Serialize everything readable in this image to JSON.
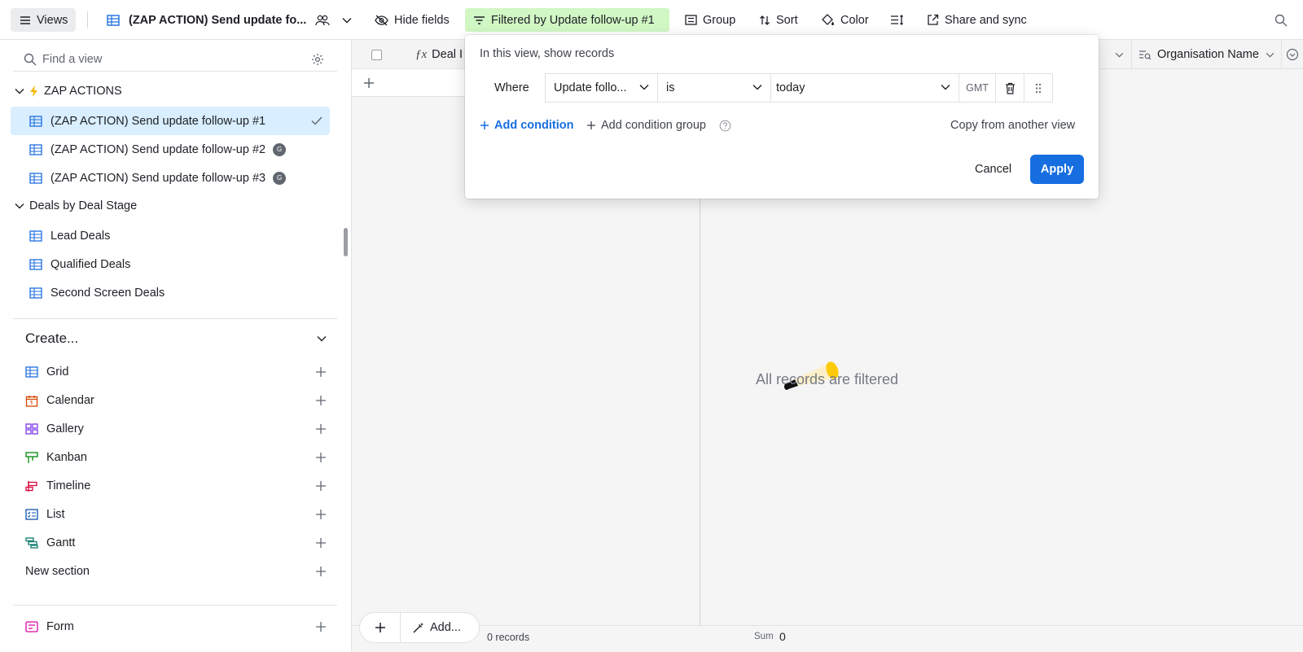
{
  "toolbar": {
    "views_label": "Views",
    "view_name": "(ZAP ACTION) Send update fo...",
    "hide_fields": "Hide fields",
    "filter": "Filtered by Update follow-up #1",
    "group": "Group",
    "sort": "Sort",
    "color": "Color",
    "share": "Share and sync"
  },
  "sidebar": {
    "find_placeholder": "Find a view",
    "sections": [
      {
        "title": "ZAP ACTIONS",
        "items": [
          {
            "label": "(ZAP ACTION) Send update follow-up #1",
            "active": true
          },
          {
            "label": "(ZAP ACTION) Send update follow-up #2",
            "badge": "G"
          },
          {
            "label": "(ZAP ACTION) Send update follow-up #3",
            "badge": "G"
          }
        ]
      },
      {
        "title": "Deals by Deal Stage",
        "items": [
          {
            "label": "Lead Deals"
          },
          {
            "label": "Qualified Deals"
          },
          {
            "label": "Second Screen Deals"
          }
        ]
      }
    ],
    "create_label": "Create...",
    "create_items": [
      {
        "label": "Grid",
        "icon": "grid-icon"
      },
      {
        "label": "Calendar",
        "icon": "calendar-icon"
      },
      {
        "label": "Gallery",
        "icon": "gallery-icon"
      },
      {
        "label": "Kanban",
        "icon": "kanban-icon"
      },
      {
        "label": "Timeline",
        "icon": "timeline-icon"
      },
      {
        "label": "List",
        "icon": "list-icon"
      },
      {
        "label": "Gantt",
        "icon": "gantt-icon"
      }
    ],
    "new_section": "New section",
    "form": "Form"
  },
  "grid": {
    "col_deal": "Deal I",
    "col_org": "Organisation Name",
    "empty_text": "All records are filtered",
    "records": "0 records",
    "sum_label": "Sum",
    "sum_value": "0",
    "add_label": "Add..."
  },
  "filter": {
    "title": "In this view, show records",
    "where": "Where",
    "field": "Update follo...",
    "operator": "is",
    "value": "today",
    "timezone": "GMT",
    "add_condition": "Add condition",
    "add_group": "Add condition group",
    "copy_from": "Copy from another view",
    "cancel": "Cancel",
    "apply": "Apply"
  },
  "colors": {
    "accent": "#166ee1",
    "filter_bg": "#d1f7c4",
    "active_view_bg": "#d9eefe"
  }
}
